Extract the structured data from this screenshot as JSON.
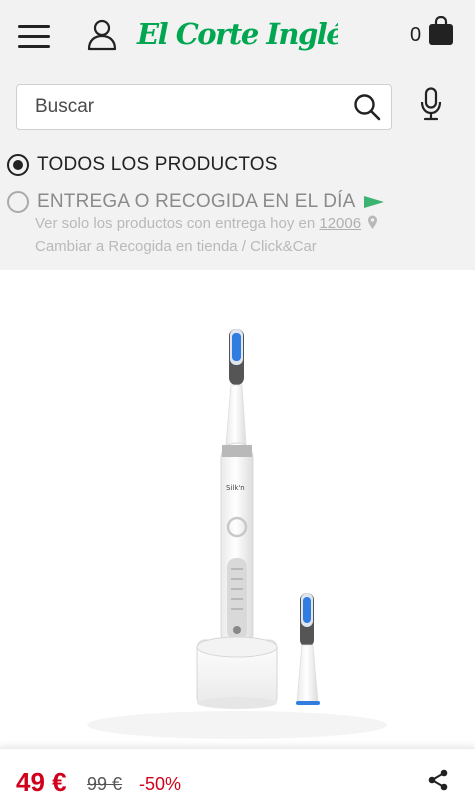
{
  "header": {
    "brand": "El Corte Inglés",
    "brand_color": "#00a650",
    "menu_icon": "hamburger-menu-icon",
    "account_icon": "user-icon",
    "cart_icon": "shopping-bag-icon",
    "cart_count": "0"
  },
  "search": {
    "placeholder": "Buscar",
    "search_icon": "search-icon",
    "voice_icon": "microphone-icon"
  },
  "filters": {
    "all_products": {
      "label": "TODOS LOS PRODUCTOS",
      "selected": true
    },
    "same_day": {
      "label": "ENTREGA O RECOGIDA EN EL DÍA",
      "selected": false,
      "flag_color": "#3cb371"
    },
    "delivery_note": "Ver solo los productos con entrega hoy en",
    "postal_code": "12006",
    "pickup_note": "Cambiar a Recogida en tienda / Click&Car"
  },
  "product": {
    "brand_on_device": "Silk'n",
    "accent_color": "#2f7de1"
  },
  "price": {
    "current": "49 €",
    "old": "99 €",
    "discount": "-50%",
    "price_color": "#d0021b",
    "share_icon": "share-icon"
  }
}
